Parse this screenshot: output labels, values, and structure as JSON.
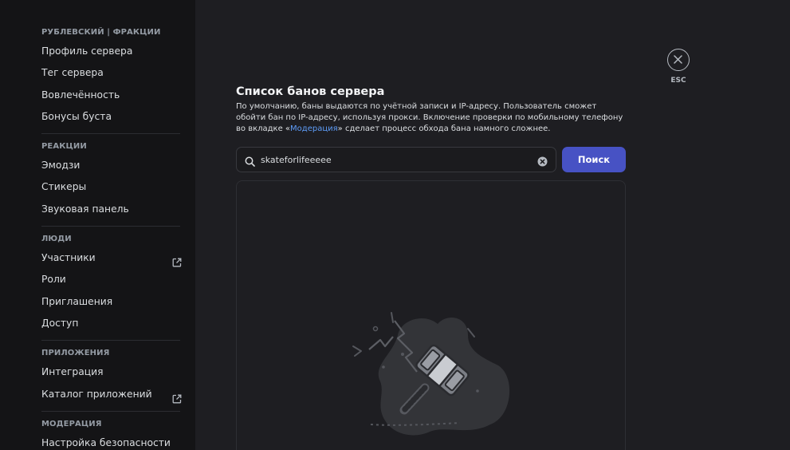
{
  "sidebar": {
    "sections": [
      {
        "header": "РУБЛЕВСКИЙ | ФРАКЦИИ",
        "items": [
          {
            "label": "Профиль сервера",
            "external": false
          },
          {
            "label": "Тег сервера",
            "external": false
          },
          {
            "label": "Вовлечённость",
            "external": false
          },
          {
            "label": "Бонусы буста",
            "external": false
          }
        ]
      },
      {
        "header": "РЕАКЦИИ",
        "items": [
          {
            "label": "Эмодзи",
            "external": false
          },
          {
            "label": "Стикеры",
            "external": false
          },
          {
            "label": "Звуковая панель",
            "external": false
          }
        ]
      },
      {
        "header": "ЛЮДИ",
        "items": [
          {
            "label": "Участники",
            "external": true
          },
          {
            "label": "Роли",
            "external": false
          },
          {
            "label": "Приглашения",
            "external": false
          },
          {
            "label": "Доступ",
            "external": false
          }
        ]
      },
      {
        "header": "ПРИЛОЖЕНИЯ",
        "items": [
          {
            "label": "Интеграция",
            "external": false
          },
          {
            "label": "Каталог приложений",
            "external": true
          }
        ]
      },
      {
        "header": "МОДЕРАЦИЯ",
        "items": [
          {
            "label": "Настройка безопасности",
            "external": false
          }
        ]
      }
    ]
  },
  "main": {
    "title": "Список банов сервера",
    "description_before": "По умолчанию, баны выдаются по учётной записи и IP-адресу. Пользователь сможет обойти бан по IP-адресу, используя прокси. Включение проверки по мобильному телефону во вкладке «",
    "description_link": "Модерация",
    "description_after": "» сделает процесс обхода бана намного сложнее.",
    "search": {
      "value": "skateforlifeeeee",
      "button_label": "Поиск",
      "icon": "search-icon",
      "clear_icon": "clear-icon"
    },
    "close": {
      "label": "ESC",
      "icon": "close-icon"
    }
  },
  "colors": {
    "accent": "#4752c4",
    "link": "#5e9cf7",
    "sidebar_bg": "#141416",
    "main_bg": "#1e1e22"
  }
}
